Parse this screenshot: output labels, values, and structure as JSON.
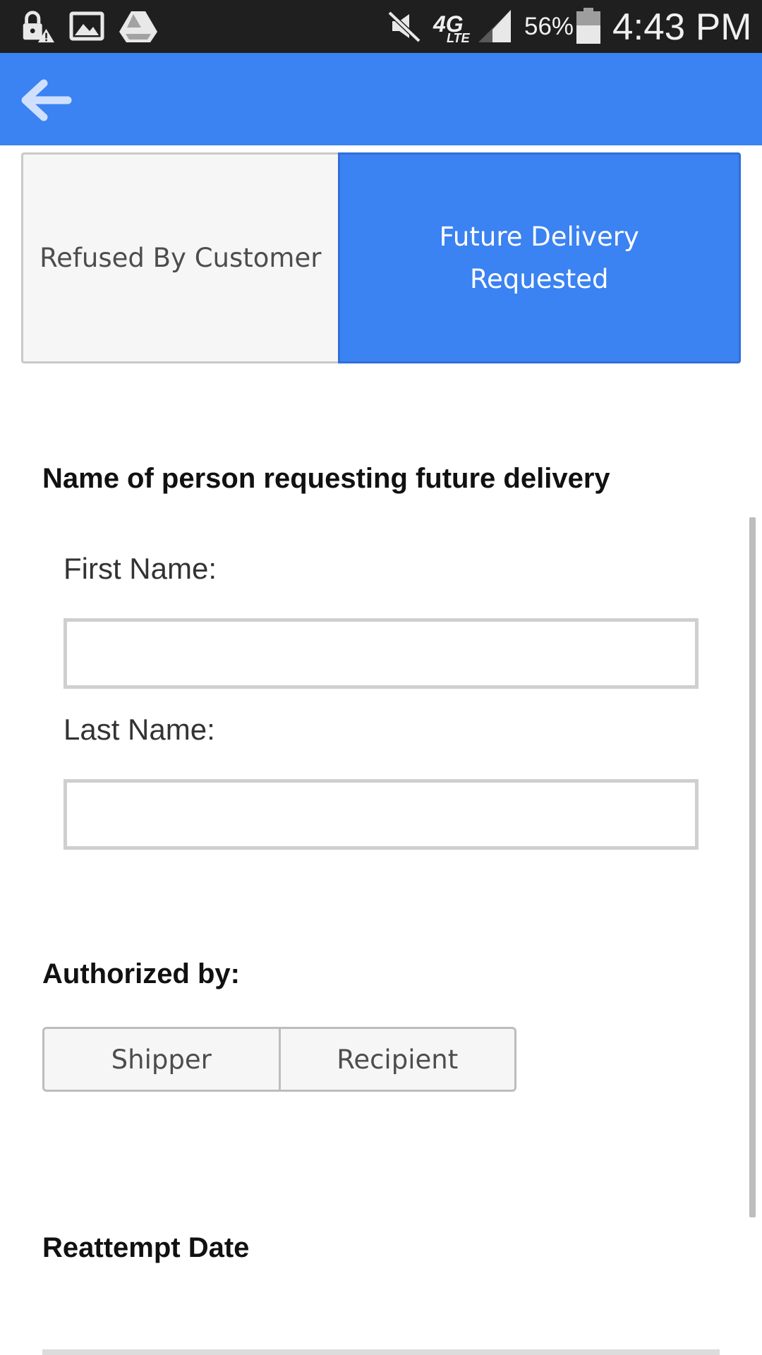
{
  "status_bar": {
    "battery_percent": "56%",
    "time": "4:43 PM",
    "network": "4G",
    "network_sub": "LTE",
    "icons": [
      "lock-warning-icon",
      "image-icon",
      "drive-icon",
      "mute-icon",
      "network-4g-lte-icon",
      "signal-icon",
      "battery-icon"
    ]
  },
  "app_bar": {
    "back_icon": "back-arrow-icon",
    "color": "#3b82f2"
  },
  "reason_selector": {
    "options": [
      {
        "label": "Refused By Customer",
        "selected": false
      },
      {
        "label": "Future Delivery Requested",
        "selected": true
      }
    ]
  },
  "requester": {
    "title": "Name of person requesting future delivery",
    "first_name_label": "First Name:",
    "first_name_value": "",
    "last_name_label": "Last Name:",
    "last_name_value": ""
  },
  "authorization": {
    "title": "Authorized by:",
    "options": [
      "Shipper",
      "Recipient"
    ]
  },
  "reattempt": {
    "title": "Reattempt Date"
  }
}
